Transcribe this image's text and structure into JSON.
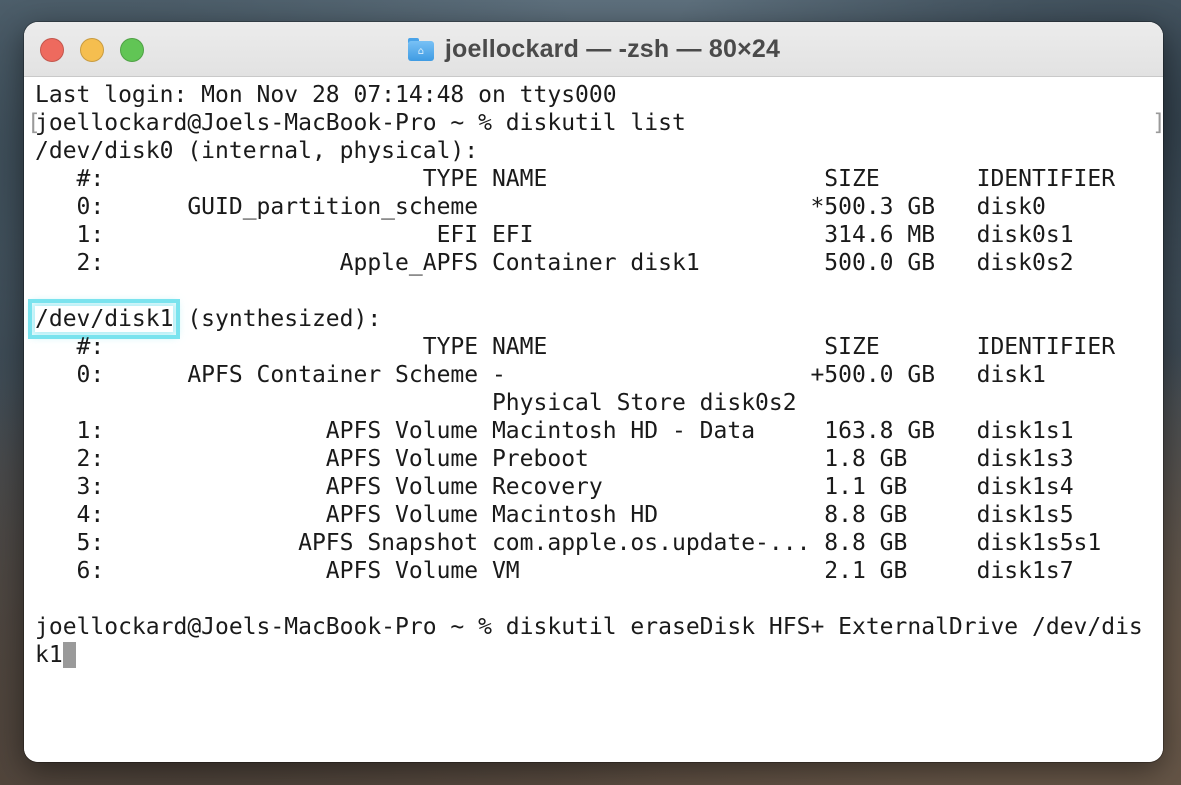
{
  "window": {
    "title": "joellockard — -zsh — 80×24",
    "icon": "home-folder-icon"
  },
  "terminal": {
    "last_login": "Last login: Mon Nov 28 07:14:48 on ttys000",
    "prompt1": "joellockard@Joels-MacBook-Pro ~ % diskutil list",
    "prompt1_left_mark": "[",
    "prompt1_right_mark": "]",
    "disk0_header": "/dev/disk0 (internal, physical):",
    "disk0_rows": [
      "   #:                       TYPE NAME                    SIZE       IDENTIFIER",
      "   0:      GUID_partition_scheme                        *500.3 GB   disk0",
      "   1:                        EFI EFI                     314.6 MB   disk0s1",
      "   2:                 Apple_APFS Container disk1         500.0 GB   disk0s2"
    ],
    "disk1_name": "/dev/disk1",
    "disk1_suffix": " (synthesized):",
    "disk1_rows": [
      "   #:                       TYPE NAME                    SIZE       IDENTIFIER",
      "   0:      APFS Container Scheme -                      +500.0 GB   disk1",
      "                                 Physical Store disk0s2",
      "   1:                APFS Volume Macintosh HD - Data     163.8 GB   disk1s1",
      "   2:                APFS Volume Preboot                 1.8 GB     disk1s3",
      "   3:                APFS Volume Recovery                1.1 GB     disk1s4",
      "   4:                APFS Volume Macintosh HD            8.8 GB     disk1s5",
      "   5:              APFS Snapshot com.apple.os.update-... 8.8 GB     disk1s5s1",
      "   6:                APFS Volume VM                      2.1 GB     disk1s7"
    ],
    "prompt2_line1": "joellockard@Joels-MacBook-Pro ~ % diskutil eraseDisk HFS+ ExternalDrive /dev/dis",
    "prompt2_line2": "k1"
  },
  "colors": {
    "highlight": "#7ae3ee",
    "close": "#ee6a5e",
    "minimize": "#f5be4f",
    "zoom": "#61c555"
  }
}
